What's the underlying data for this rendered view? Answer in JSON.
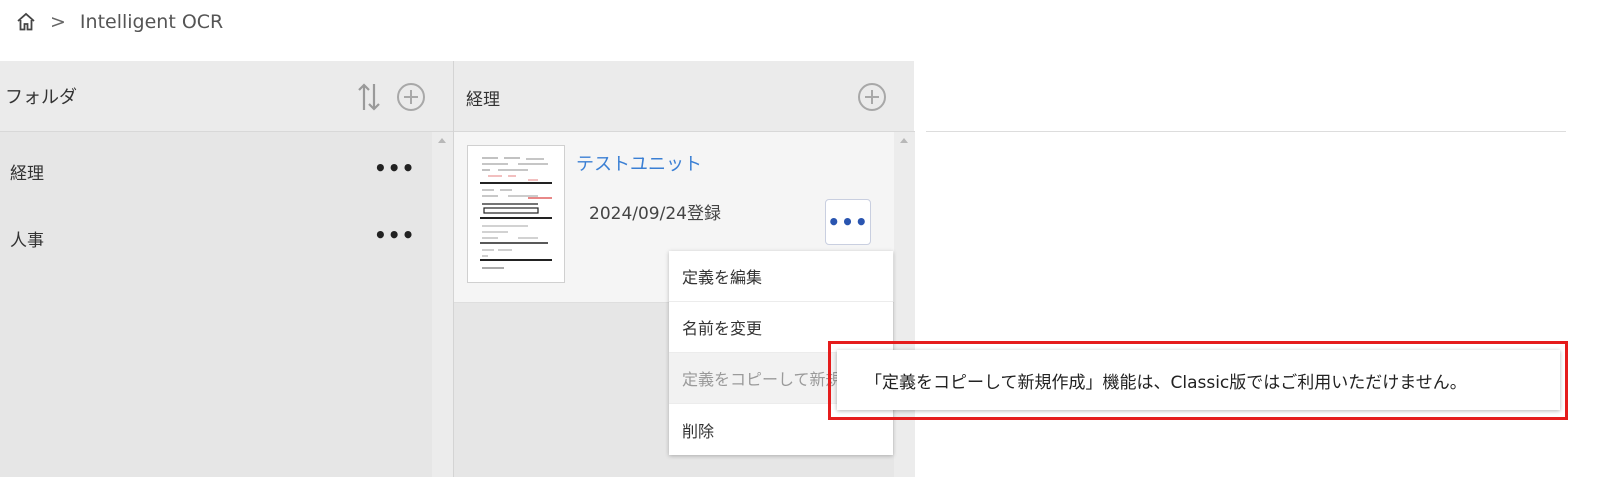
{
  "breadcrumb": {
    "home_icon": "home-icon",
    "separator": ">",
    "current": "Intelligent OCR"
  },
  "folder_panel": {
    "title": "フォルダ",
    "sort_icon": "sort-icon",
    "add_icon": "plus-circle-icon",
    "items": [
      {
        "label": "経理",
        "more": "•••"
      },
      {
        "label": "人事",
        "more": "•••"
      }
    ]
  },
  "unit_panel": {
    "title": "経理",
    "add_icon": "plus-circle-icon",
    "units": [
      {
        "name": "テストユニット",
        "date": "2024/09/24登録",
        "more": "•••"
      }
    ]
  },
  "context_menu": {
    "items": [
      {
        "label": "定義を編集",
        "disabled": false
      },
      {
        "label": "名前を変更",
        "disabled": false
      },
      {
        "label": "定義をコピーして新規作成",
        "disabled": true
      },
      {
        "label": "削除",
        "disabled": false
      }
    ]
  },
  "tooltip": {
    "text": "「定義をコピーして新規作成」機能は、Classic版ではご利用いただけません。"
  },
  "colors": {
    "link": "#3a7fd4",
    "highlight_border": "#e51c1c",
    "panel_bg": "#e6e6e6"
  }
}
